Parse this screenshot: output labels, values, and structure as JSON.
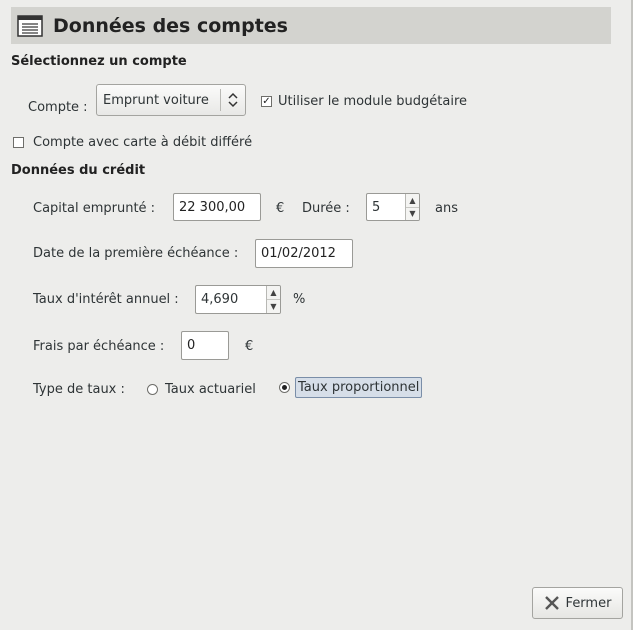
{
  "header": {
    "title": "Données des comptes",
    "icon": "list-icon"
  },
  "account_section": {
    "title": "Sélectionnez un compte",
    "account_label": "Compte :",
    "account_value": "Emprunt voiture",
    "budget_label": "Utiliser le module budgétaire",
    "budget_checked": true,
    "deferred_label": "Compte avec carte à débit différé",
    "deferred_checked": false
  },
  "credit_section": {
    "title": "Données du crédit",
    "capital_label": "Capital emprunté :",
    "capital_value": "22 300,00",
    "currency": "€",
    "duration_label": "Durée :",
    "duration_value": "5",
    "duration_unit": "ans",
    "first_due_label": "Date de la première échéance :",
    "first_due_value": "01/02/2012",
    "rate_label": "Taux d'intérêt annuel :",
    "rate_value": "4,690",
    "rate_unit": "%",
    "fees_label": "Frais par échéance :",
    "fees_value": "0",
    "fees_unit": "€",
    "rate_type_label": "Type de taux :",
    "rate_actuarial": "Taux actuariel",
    "rate_proportional": "Taux proportionnel",
    "selected_rate_type": "Taux proportionnel"
  },
  "footer": {
    "close_label": "Fermer"
  }
}
